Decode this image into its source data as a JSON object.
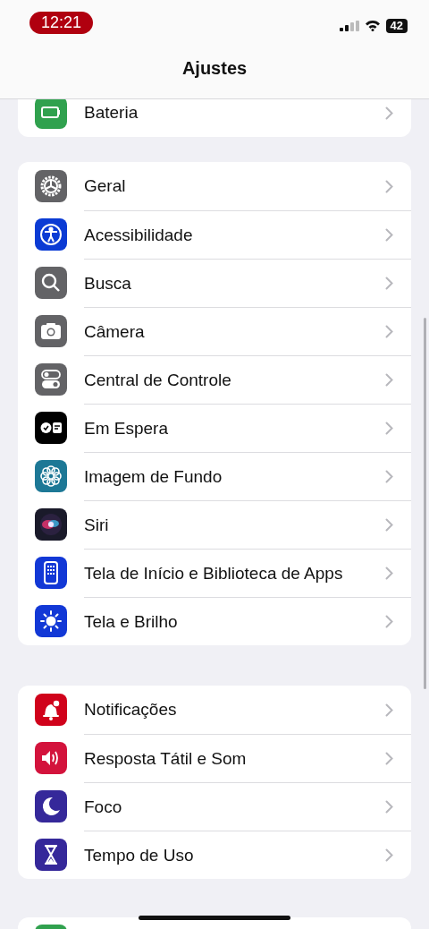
{
  "status_bar": {
    "time": "12:21",
    "battery": "42"
  },
  "title": "Ajustes",
  "groups": [
    {
      "items": [
        {
          "kind": "battery",
          "label": "Bateria"
        }
      ]
    },
    {
      "items": [
        {
          "kind": "general",
          "label": "Geral"
        },
        {
          "kind": "accessibility",
          "label": "Acessibilidade"
        },
        {
          "kind": "search",
          "label": "Busca"
        },
        {
          "kind": "camera",
          "label": "Câmera"
        },
        {
          "kind": "control",
          "label": "Central de Controle"
        },
        {
          "kind": "standby",
          "label": "Em Espera"
        },
        {
          "kind": "wallpaper",
          "label": "Imagem de Fundo"
        },
        {
          "kind": "siri",
          "label": "Siri"
        },
        {
          "kind": "homescreen",
          "label": "Tela de Início e Biblioteca de Apps"
        },
        {
          "kind": "display",
          "label": "Tela e Brilho"
        }
      ]
    },
    {
      "items": [
        {
          "kind": "notifications",
          "label": "Notificações"
        },
        {
          "kind": "sounds",
          "label": "Resposta Tátil e Som"
        },
        {
          "kind": "focus",
          "label": "Foco"
        },
        {
          "kind": "screentime",
          "label": "Tempo de Uso"
        }
      ]
    },
    {
      "items": [
        {
          "kind": "privacy"
        }
      ]
    }
  ]
}
